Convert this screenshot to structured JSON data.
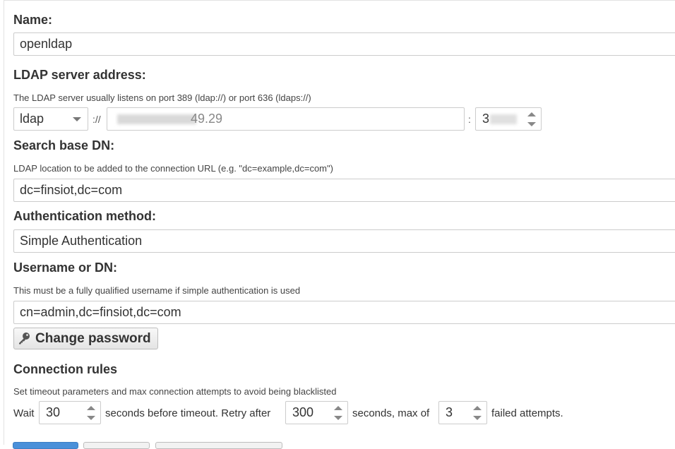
{
  "name": {
    "label": "Name:",
    "value": "openldap"
  },
  "server": {
    "label": "LDAP server address:",
    "hint": "The LDAP server usually listens on port 389 (ldap://) or port 636 (ldaps://)",
    "protocol": "ldap",
    "separator": "://",
    "host_visible_suffix": "49.29",
    "port_separator": ":",
    "port_visible": "3"
  },
  "base_dn": {
    "label": "Search base DN:",
    "hint": "LDAP location to be added to the connection URL (e.g. \"dc=example,dc=com\")",
    "value": "dc=finsiot,dc=com"
  },
  "auth": {
    "label": "Authentication method:",
    "value": "Simple Authentication"
  },
  "username": {
    "label": "Username or DN:",
    "hint": "This must be a fully qualified username if simple authentication is used",
    "value": "cn=admin,dc=finsiot,dc=com"
  },
  "password_button": {
    "label": "Change password",
    "icon": "key-icon"
  },
  "rules": {
    "label": "Connection rules",
    "hint": "Set timeout parameters and max connection attempts to avoid being blacklisted",
    "wait": "Wait",
    "timeout_value": "30",
    "timeout_text": "seconds before timeout. Retry after",
    "retry_value": "300",
    "retry_text": "seconds, max of",
    "attempts_value": "3",
    "attempts_text": "failed attempts."
  },
  "colors": {
    "border": "#cccccc",
    "text": "#333333",
    "primary_button": "#4a90d9"
  }
}
